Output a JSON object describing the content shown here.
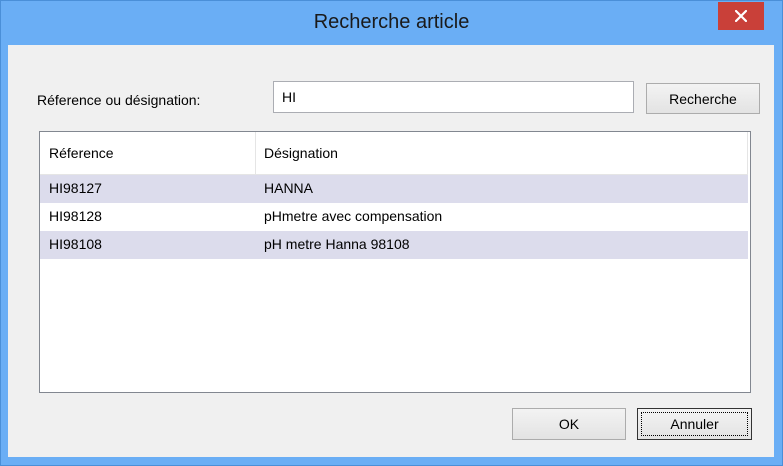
{
  "window": {
    "title": "Recherche article"
  },
  "search": {
    "label": "Réference ou désignation:",
    "value": "HI",
    "button_label": "Recherche"
  },
  "table": {
    "columns": [
      "Réference",
      "Désignation"
    ],
    "rows": [
      {
        "reference": "HI98127",
        "designation": "HANNA"
      },
      {
        "reference": "HI98128",
        "designation": "pHmetre avec compensation"
      },
      {
        "reference": "HI98108",
        "designation": "pH metre Hanna 98108"
      }
    ]
  },
  "buttons": {
    "ok": "OK",
    "cancel": "Annuler"
  },
  "colors": {
    "titlebar": "#6aaef5",
    "close_button": "#c94039",
    "row_alt": "#dcdcec"
  },
  "icons": {
    "close": "close-icon"
  }
}
